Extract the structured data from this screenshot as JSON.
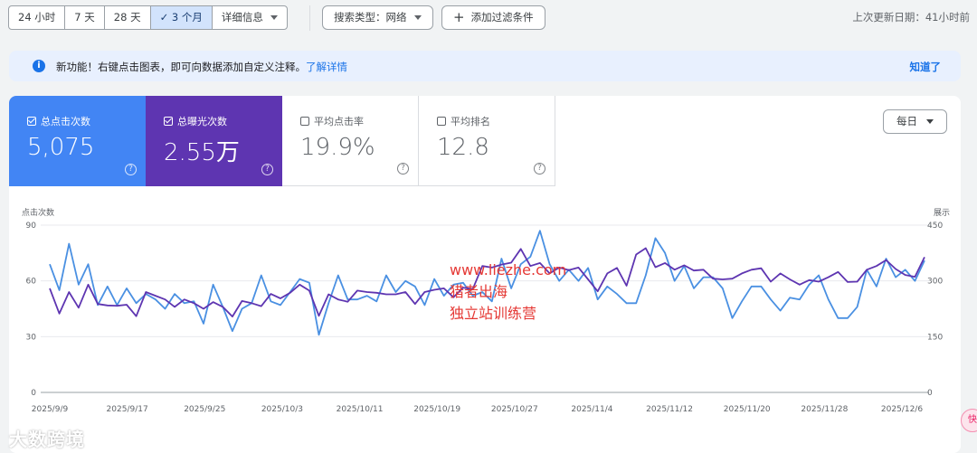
{
  "toolbar": {
    "ranges": [
      {
        "label": "24 小时",
        "active": false
      },
      {
        "label": "7 天",
        "active": false
      },
      {
        "label": "28 天",
        "active": false
      },
      {
        "label": "✓ 3 个月",
        "active": true
      },
      {
        "label": "详细信息",
        "active": false
      }
    ],
    "search_type": "搜索类型：网络",
    "add_filter": "添加过滤条件",
    "last_updated": "上次更新日期：41小时前"
  },
  "banner": {
    "text": "新功能！右键点击图表，即可向数据添加自定义注释。",
    "link": "了解详情",
    "dismiss": "知道了"
  },
  "metrics": [
    {
      "label": "总点击次数",
      "value": "5,075",
      "checked": true
    },
    {
      "label": "总曝光次数",
      "value": "2.55万",
      "checked": true
    },
    {
      "label": "平均点击率",
      "value": "19.9%",
      "checked": false
    },
    {
      "label": "平均排名",
      "value": "12.8",
      "checked": false
    }
  ],
  "granularity": "每日",
  "watermark": [
    "www.liezhe.com",
    "猎者出海",
    "独立站训练营"
  ],
  "logo_text": "大数跨境",
  "bubble_text": "快",
  "colors": {
    "clicks": "#4a90e2",
    "impressions": "#5e35b1",
    "accent": "#1a73e8"
  },
  "chart_data": {
    "type": "line",
    "left_axis_label": "点击次数",
    "right_axis_label": "展示",
    "left_ticks": [
      "90",
      "60",
      "30",
      "0"
    ],
    "right_ticks": [
      "450",
      "300",
      "150",
      "0"
    ],
    "left_range": [
      0,
      90
    ],
    "right_range": [
      0,
      450
    ],
    "x_labels": [
      "2025/9/9",
      "2025/9/17",
      "2025/9/25",
      "2025/10/3",
      "2025/10/11",
      "2025/10/19",
      "2025/10/27",
      "2025/11/4",
      "2025/11/12",
      "2025/11/20",
      "2025/11/28",
      "2025/12/6"
    ],
    "x_count": 92,
    "series": [
      {
        "name": "点击次数",
        "axis": "left",
        "values": [
          69,
          55,
          80,
          58,
          69,
          47,
          57,
          47,
          56,
          48,
          53,
          50,
          45,
          53,
          48,
          49,
          37,
          58,
          46,
          33,
          45,
          48,
          63,
          49,
          47,
          54,
          61,
          59,
          31,
          48,
          63,
          50,
          50,
          52,
          49,
          63,
          54,
          60,
          57,
          47,
          61,
          52,
          58,
          59,
          52,
          54,
          49,
          72,
          56,
          69,
          73,
          87,
          69,
          60,
          66,
          60,
          67,
          50,
          57,
          53,
          48,
          48,
          63,
          83,
          75,
          60,
          68,
          56,
          62,
          62,
          56,
          40,
          49,
          57,
          57,
          50,
          44,
          51,
          50,
          58,
          63,
          50,
          40,
          40,
          46,
          66,
          57,
          72,
          62,
          66,
          60,
          71
        ]
      },
      {
        "name": "展示",
        "axis": "right",
        "values": [
          280,
          212,
          270,
          228,
          290,
          238,
          234,
          233,
          236,
          205,
          270,
          260,
          250,
          230,
          250,
          240,
          225,
          243,
          230,
          204,
          246,
          240,
          232,
          265,
          253,
          268,
          290,
          274,
          206,
          264,
          250,
          244,
          274,
          270,
          268,
          264,
          264,
          270,
          238,
          270,
          276,
          280,
          256,
          282,
          278,
          340,
          336,
          344,
          349,
          386,
          340,
          348,
          320,
          336,
          329,
          336,
          304,
          272,
          320,
          335,
          287,
          371,
          388,
          337,
          348,
          330,
          342,
          328,
          330,
          306,
          304,
          306,
          320,
          330,
          334,
          298,
          320,
          304,
          290,
          302,
          298,
          310,
          324,
          297,
          298,
          330,
          340,
          356,
          332,
          316,
          311,
          364
        ]
      }
    ]
  }
}
